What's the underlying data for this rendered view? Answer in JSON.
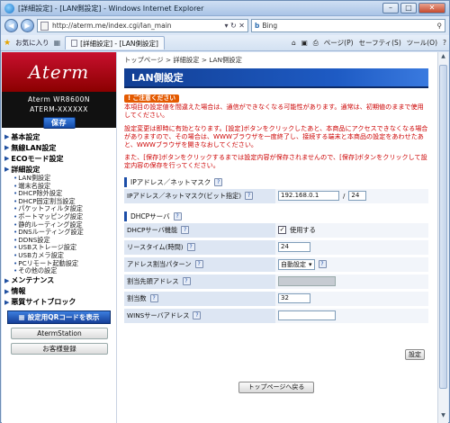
{
  "window": {
    "title": "[詳細設定] - [LAN側設定] - Windows Internet Explorer"
  },
  "address": {
    "url": "http://aterm.me/index.cgi/lan_main",
    "search_engine": "Bing"
  },
  "toolbar": {
    "favorites": "お気に入り",
    "tab_title": "[詳細設定] - [LAN側設定]",
    "page_menu": "ページ(P)",
    "safety_menu": "セーフティ(S)",
    "tools_menu": "ツール(O)",
    "help_menu": "?"
  },
  "sidebar": {
    "logo": "Aterm",
    "model_line1": "Aterm WR8600N",
    "model_line2": "ATERM-XXXXXX",
    "save": "保存",
    "menu": [
      {
        "type": "head",
        "label": "基本設定"
      },
      {
        "type": "head",
        "label": "無線LAN設定"
      },
      {
        "type": "head",
        "label": "ECOモード設定"
      },
      {
        "type": "head",
        "label": "詳細設定"
      },
      {
        "type": "sub",
        "label": "LAN側設定"
      },
      {
        "type": "sub",
        "label": "端末名設定"
      },
      {
        "type": "sub",
        "label": "DHCP除外設定"
      },
      {
        "type": "sub",
        "label": "DHCP固定割当設定"
      },
      {
        "type": "sub",
        "label": "パケットフィルタ設定"
      },
      {
        "type": "sub",
        "label": "ポートマッピング設定"
      },
      {
        "type": "sub",
        "label": "静的ルーティング設定"
      },
      {
        "type": "sub",
        "label": "DNSルーティング設定"
      },
      {
        "type": "sub",
        "label": "DDNS設定"
      },
      {
        "type": "sub",
        "label": "USBストレージ設定"
      },
      {
        "type": "sub",
        "label": "USBカメラ設定"
      },
      {
        "type": "sub",
        "label": "PCリモート起動設定"
      },
      {
        "type": "sub",
        "label": "その他の設定"
      },
      {
        "type": "head",
        "label": "メンテナンス"
      },
      {
        "type": "head",
        "label": "情報"
      },
      {
        "type": "head",
        "label": "悪質サイトブロック"
      }
    ],
    "qr_button": "設定用QRコードを表示",
    "aterm_station": "AtermStation",
    "customer_reg": "お客様登録"
  },
  "main": {
    "breadcrumb": "トップページ > 詳細設定 > LAN側設定",
    "title": "LAN側設定",
    "notice_tag": "ご注意ください",
    "notice_p1": "本項目の設定値を間違えた場合は、通信ができなくなる可能性があります。通常は、初期値のままで使用してください。",
    "notice_p2": "設定変更は即時に有効となります。[設定]ボタンをクリックしたあと、本商品にアクセスできなくなる場合がありますので、その場合は、WWWブラウザを一度終了し、接続する端末と本商品の設定をあわせたあと、WWWブラウザを開きなおしてください。",
    "notice_p3": "また、[保存]ボタンをクリックするまでは設定内容が保存されませんので、[保存]ボタンをクリックして設定内容の保存を行ってください。",
    "ip_section": "IPアドレス／ネットマスク",
    "ip_label": "IPアドレス／ネットマスク(ビット指定)",
    "ip_value": "192.168.0.1",
    "mask_sep": "/",
    "mask_value": "24",
    "dhcp_section": "DHCPサーバ",
    "dhcp_fn_label": "DHCPサーバ機能",
    "dhcp_use": "使用する",
    "lease_label": "リースタイム(時間)",
    "lease_value": "24",
    "pattern_label": "アドレス割当パターン",
    "pattern_value": "自動設定",
    "start_label": "割当先頭アドレス",
    "count_label": "割当数",
    "count_value": "32",
    "wins_label": "WINSサーバアドレス",
    "wins_value": "",
    "set_button": "設定",
    "top_button": "トップページへ戻る"
  }
}
